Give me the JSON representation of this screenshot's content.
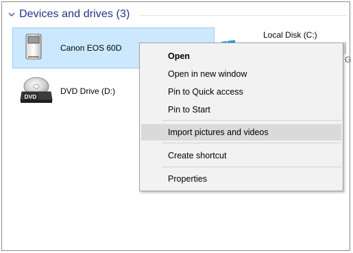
{
  "section": {
    "title": "Devices and drives (3)"
  },
  "devices": [
    {
      "label": "Canon EOS 60D",
      "icon": "camera-device-icon",
      "selected": true
    },
    {
      "label": "DVD Drive (D:)",
      "icon": "dvd-drive-icon",
      "badge": "DVD"
    },
    {
      "label": "Local Disk (C:)",
      "icon": "windows-logo-icon",
      "truncated_text": "G"
    }
  ],
  "context_menu": {
    "items": [
      {
        "label": "Open",
        "bold": true
      },
      {
        "label": "Open in new window"
      },
      {
        "label": "Pin to Quick access"
      },
      {
        "label": "Pin to Start"
      },
      {
        "label": "Import pictures and videos",
        "highlighted": true
      },
      {
        "label": "Create shortcut"
      },
      {
        "label": "Properties"
      }
    ]
  },
  "colors": {
    "header_text": "#1e3287",
    "selection_fill": "#cce8ff",
    "selection_border": "#99d1ff",
    "menu_background": "#f2f2f2",
    "menu_highlight": "#dadada",
    "windows_blue": "#1a9bd7"
  }
}
